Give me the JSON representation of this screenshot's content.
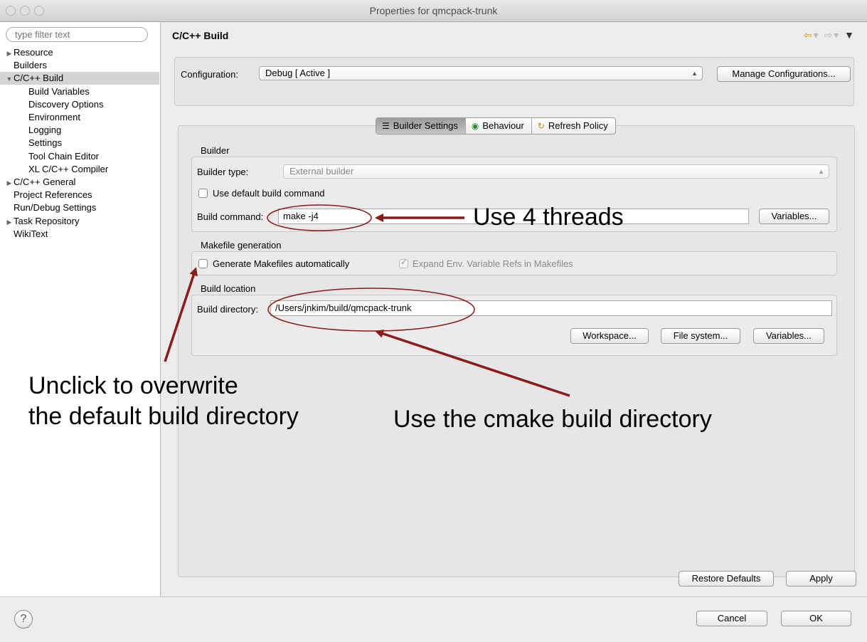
{
  "window": {
    "title": "Properties for qmcpack-trunk"
  },
  "sidebar": {
    "filter_placeholder": "type filter text",
    "items": [
      {
        "label": "Resource",
        "indent": 0,
        "expander": "▶"
      },
      {
        "label": "Builders",
        "indent": 0,
        "expander": ""
      },
      {
        "label": "C/C++ Build",
        "indent": 0,
        "expander": "▼",
        "selected": true
      },
      {
        "label": "Build Variables",
        "indent": 1,
        "expander": ""
      },
      {
        "label": "Discovery Options",
        "indent": 1,
        "expander": ""
      },
      {
        "label": "Environment",
        "indent": 1,
        "expander": ""
      },
      {
        "label": "Logging",
        "indent": 1,
        "expander": ""
      },
      {
        "label": "Settings",
        "indent": 1,
        "expander": ""
      },
      {
        "label": "Tool Chain Editor",
        "indent": 1,
        "expander": ""
      },
      {
        "label": "XL C/C++ Compiler",
        "indent": 1,
        "expander": ""
      },
      {
        "label": "C/C++ General",
        "indent": 0,
        "expander": "▶"
      },
      {
        "label": "Project References",
        "indent": 0,
        "expander": ""
      },
      {
        "label": "Run/Debug Settings",
        "indent": 0,
        "expander": ""
      },
      {
        "label": "Task Repository",
        "indent": 0,
        "expander": "▶"
      },
      {
        "label": "WikiText",
        "indent": 0,
        "expander": ""
      }
    ]
  },
  "main": {
    "title": "C/C++ Build",
    "configuration_label": "Configuration:",
    "configuration_value": "Debug  [ Active ]",
    "manage_configurations": "Manage Configurations...",
    "tabs": [
      {
        "label": "Builder Settings",
        "icon": "list-icon",
        "glyph": "☰",
        "active": true
      },
      {
        "label": "Behaviour",
        "icon": "radio-icon",
        "glyph": "◉",
        "active": false
      },
      {
        "label": "Refresh Policy",
        "icon": "refresh-icon",
        "glyph": "↻",
        "active": false
      }
    ],
    "builder": {
      "section": "Builder",
      "type_label": "Builder type:",
      "type_value": "External builder",
      "use_default_label": "Use default build command",
      "command_label": "Build command:",
      "command_value": "make -j4",
      "variables": "Variables..."
    },
    "makefile": {
      "section": "Makefile generation",
      "generate_label": "Generate Makefiles automatically",
      "expand_label": "Expand Env. Variable Refs in Makefiles"
    },
    "location": {
      "section": "Build location",
      "directory_label": "Build directory:",
      "directory_value": "/Users/jnkim/build/qmcpack-trunk",
      "workspace": "Workspace...",
      "filesystem": "File system...",
      "variables": "Variables..."
    },
    "restore_defaults": "Restore Defaults",
    "apply": "Apply"
  },
  "bottom": {
    "help": "?",
    "cancel": "Cancel",
    "ok": "OK"
  },
  "annotations": {
    "threads": "Use 4 threads",
    "unclick_line1": "Unclick to overwrite",
    "unclick_line2": "the default build directory",
    "cmake": "Use the cmake build directory"
  },
  "colors": {
    "annotation": "#8b1a1a",
    "selection": "#d4d4d4"
  }
}
